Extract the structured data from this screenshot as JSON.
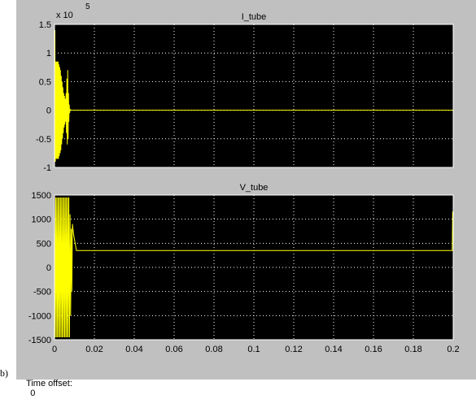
{
  "footer": {
    "panel_label": "b)",
    "time_offset_label": "Time offset:",
    "time_offset_value": "0"
  },
  "colors": {
    "window_bg": "#c0c0c0",
    "axes_bg": "#000000",
    "trace": "#ffff00",
    "grid": "#ffffff"
  },
  "chart_data": [
    {
      "type": "line",
      "title": "I_tube",
      "exponent_label": "x 10",
      "exponent_power": "5",
      "xlim": [
        0,
        0.2
      ],
      "ylim": [
        -1,
        1.5
      ],
      "xticks": [
        0,
        0.02,
        0.04,
        0.06,
        0.08,
        0.1,
        0.12,
        0.14,
        0.16,
        0.18,
        0.2
      ],
      "yticks": [
        -1,
        -0.5,
        0,
        0.5,
        1,
        1.5
      ],
      "ytick_labels": [
        "-1",
        "-0.5",
        "0",
        "0.5",
        "1",
        "1.5"
      ],
      "xtick_labels": [],
      "grid": true,
      "series": [
        {
          "x": [
            0,
            0.0002,
            0.0004,
            0.0006,
            0.0008,
            0.001,
            0.0012,
            0.0014,
            0.0016,
            0.0018,
            0.002,
            0.0022,
            0.0024,
            0.0026,
            0.0028,
            0.003,
            0.0032,
            0.0034,
            0.0036,
            0.0038,
            0.004,
            0.0042,
            0.0044,
            0.0046,
            0.0048,
            0.005,
            0.0052,
            0.0054,
            0.0056,
            0.0058,
            0.006,
            0.0062,
            0.0064,
            0.0066,
            0.0068,
            0.007,
            0.0072,
            0.0074,
            0.0076,
            0.0078,
            0.008,
            0.0085,
            0.009,
            0.2
          ],
          "y": [
            0,
            1.4,
            -0.9,
            0.85,
            -0.85,
            0.85,
            -0.85,
            0.85,
            -0.85,
            0.85,
            -0.85,
            0.8,
            -0.8,
            0.75,
            -0.75,
            0.7,
            -0.7,
            0.6,
            -0.6,
            0.5,
            -0.5,
            0.4,
            -0.4,
            0.3,
            -0.3,
            0.25,
            -0.25,
            0.2,
            -0.2,
            0.3,
            -0.4,
            0.55,
            -0.6,
            0.7,
            -0.5,
            0.3,
            -0.2,
            0.1,
            -0.05,
            0.02,
            0,
            0,
            0,
            0
          ]
        }
      ]
    },
    {
      "type": "line",
      "title": "V_tube",
      "xlim": [
        0,
        0.2
      ],
      "ylim": [
        -1500,
        1500
      ],
      "xticks": [
        0,
        0.02,
        0.04,
        0.06,
        0.08,
        0.1,
        0.12,
        0.14,
        0.16,
        0.18,
        0.2
      ],
      "xtick_labels": [
        "0",
        "0.02",
        "0.04",
        "0.06",
        "0.08",
        "0.1",
        "0.12",
        "0.14",
        "0.16",
        "0.18",
        "0.2"
      ],
      "yticks": [
        -1500,
        -1000,
        -500,
        0,
        500,
        1000,
        1500
      ],
      "ytick_labels": [
        "-1500",
        "-1000",
        "-500",
        "0",
        "500",
        "1000",
        "1500"
      ],
      "grid": true,
      "series": [
        {
          "x": [
            0,
            0.0003,
            0.0006,
            0.0009,
            0.0012,
            0.0015,
            0.0018,
            0.0021,
            0.0024,
            0.0027,
            0.003,
            0.0033,
            0.0036,
            0.0039,
            0.0042,
            0.0045,
            0.0048,
            0.0051,
            0.0054,
            0.0057,
            0.006,
            0.0063,
            0.0066,
            0.0069,
            0.0072,
            0.0075,
            0.0078,
            0.0081,
            0.0084,
            0.0087,
            0.009,
            0.0095,
            0.011,
            0.1995,
            0.1997,
            0.2
          ],
          "y": [
            1450,
            -1450,
            1450,
            -1450,
            1450,
            -1450,
            1450,
            -1450,
            1450,
            -1450,
            1450,
            -1450,
            1450,
            -1450,
            1450,
            -1450,
            1450,
            -1450,
            1450,
            -1450,
            1450,
            -1450,
            1450,
            -1450,
            1450,
            -1450,
            1100,
            -1000,
            800,
            -500,
            900,
            700,
            350,
            350,
            1150,
            1150
          ]
        }
      ]
    }
  ]
}
